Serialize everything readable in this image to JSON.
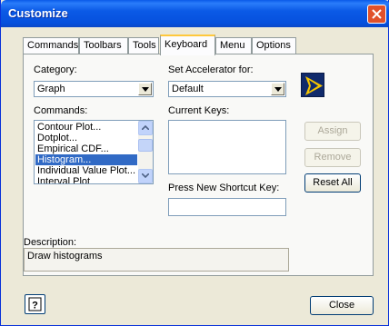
{
  "window": {
    "title": "Customize"
  },
  "tabs": [
    {
      "label": "Commands"
    },
    {
      "label": "Toolbars"
    },
    {
      "label": "Tools"
    },
    {
      "label": "Keyboard"
    },
    {
      "label": "Menu"
    },
    {
      "label": "Options"
    }
  ],
  "active_tab": "Keyboard",
  "category": {
    "label": "Category:",
    "value": "Graph"
  },
  "accelerator": {
    "label": "Set Accelerator for:",
    "value": "Default"
  },
  "commands": {
    "label": "Commands:",
    "items": [
      "Contour Plot...",
      "Dotplot...",
      "Empirical CDF...",
      "Histogram...",
      "Individual Value Plot...",
      "Interval Plot"
    ],
    "selected": "Histogram..."
  },
  "current_keys": {
    "label": "Current Keys:"
  },
  "shortcut": {
    "label": "Press New Shortcut Key:",
    "value": ""
  },
  "buttons": {
    "assign": "Assign",
    "remove": "Remove",
    "reset_all": "Reset All",
    "close": "Close"
  },
  "description": {
    "label": "Description:",
    "text": "Draw histograms"
  },
  "icons": {
    "accelerator": "arrow-play-icon",
    "help": "help-icon",
    "title_close": "close-icon"
  },
  "colors": {
    "titlebar": "#0a59e8",
    "selection": "#316ac5",
    "accel_icon_yellow": "#f5c400",
    "accel_icon_navy": "#102a6b"
  }
}
